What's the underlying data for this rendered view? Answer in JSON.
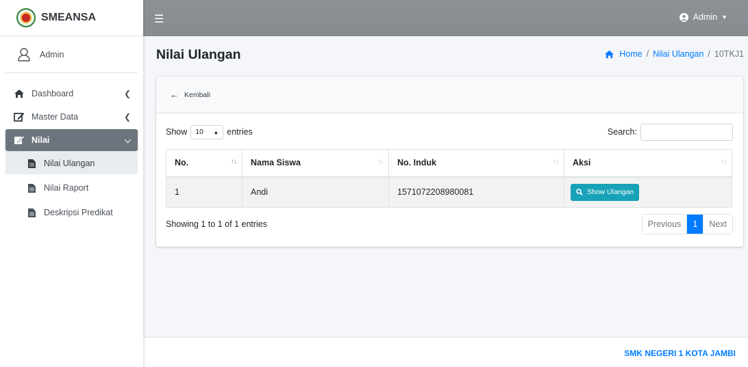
{
  "brand": {
    "name": "SMEANSA"
  },
  "user_panel": {
    "name": "Admin"
  },
  "sidebar": {
    "items": [
      {
        "label": "Dashboard",
        "icon": "home-icon"
      },
      {
        "label": "Master Data",
        "icon": "edit-icon"
      },
      {
        "label": "Nilai",
        "icon": "signature-icon",
        "active": true
      }
    ],
    "sub_items": [
      {
        "label": "Nilai Ulangan",
        "icon": "file-icon",
        "current": true
      },
      {
        "label": "Nilai Raport",
        "icon": "file-icon"
      },
      {
        "label": "Deskripsi Predikat",
        "icon": "file-icon"
      }
    ]
  },
  "topbar": {
    "user_label": "Admin"
  },
  "page": {
    "title": "Nilai Ulangan",
    "breadcrumb": [
      "Home",
      "Nilai Ulangan",
      "10TKJ1"
    ]
  },
  "card": {
    "back_label": "Kembali",
    "show_label": "Show",
    "entries_value": "10",
    "entries_label": "entries",
    "search_label": "Search:",
    "search_value": "",
    "columns": [
      "No.",
      "Nama Siswa",
      "No. Induk",
      "Aksi"
    ],
    "rows": [
      {
        "no": "1",
        "nama": "Andi",
        "induk": "1571072208980081",
        "action": "Show Ulangan"
      }
    ],
    "info": "Showing 1 to 1 of 1 entries",
    "pagination": {
      "previous": "Previous",
      "current": "1",
      "next": "Next"
    }
  },
  "footer": {
    "text": "SMK NEGERI 1 KOTA JAMBI"
  },
  "colors": {
    "accent": "#007bff",
    "info": "#17a2b8",
    "active_nav": "#6c757d",
    "topbar": "#8a8f94"
  }
}
